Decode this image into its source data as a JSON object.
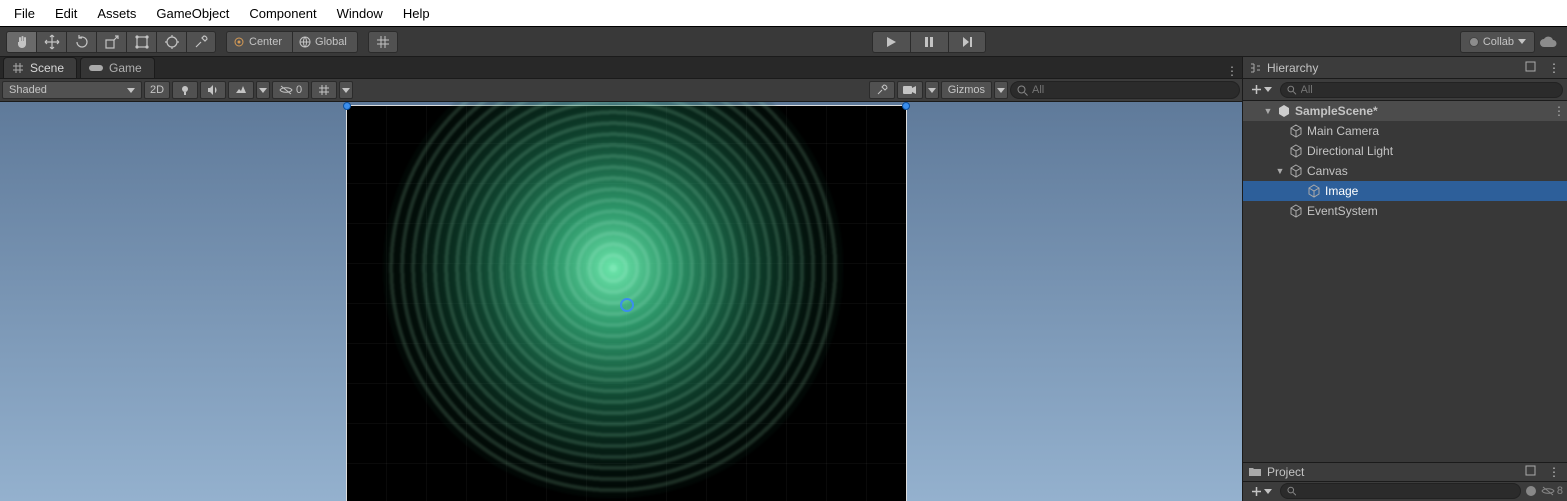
{
  "menu": {
    "items": [
      "File",
      "Edit",
      "Assets",
      "GameObject",
      "Component",
      "Window",
      "Help"
    ]
  },
  "toolbar": {
    "pivot_label": "Center",
    "space_label": "Global",
    "collab_label": "Collab"
  },
  "tabs": {
    "scene": "Scene",
    "game": "Game"
  },
  "scene_toolbar": {
    "shading": "Shaded",
    "mode2d": "2D",
    "hidden_count": "0",
    "gizmos": "Gizmos",
    "search_placeholder": "All"
  },
  "hierarchy": {
    "title": "Hierarchy",
    "search_placeholder": "All",
    "scene": "SampleScene*",
    "items": [
      {
        "label": "Main Camera",
        "depth": 1,
        "selected": false
      },
      {
        "label": "Directional Light",
        "depth": 1,
        "selected": false
      },
      {
        "label": "Canvas",
        "depth": 1,
        "selected": false,
        "expanded": true
      },
      {
        "label": "Image",
        "depth": 2,
        "selected": true
      },
      {
        "label": "EventSystem",
        "depth": 1,
        "selected": false
      }
    ]
  },
  "project": {
    "title": "Project",
    "hidden_count": "8"
  }
}
